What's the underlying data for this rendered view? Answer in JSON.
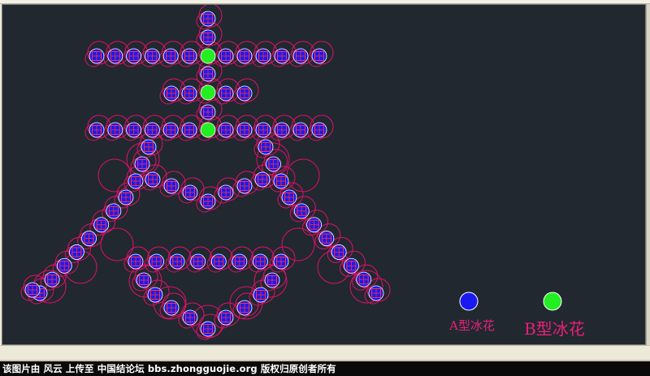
{
  "drawing": {
    "legend": {
      "a_label": "A型冰花",
      "b_label": "B型冰花"
    },
    "colors": {
      "background": "#212830",
      "type_a_fill": "#1a1af0",
      "type_b_fill": "#22ee22",
      "outline_ring": "#e0106a",
      "grid_inner": "#ff3030",
      "label_color": "#e8207a"
    }
  },
  "watermark": {
    "text": "该图片由 风云 上传至 中国结论坛 bbs.zhongguojie.org 版权归原创者所有"
  }
}
